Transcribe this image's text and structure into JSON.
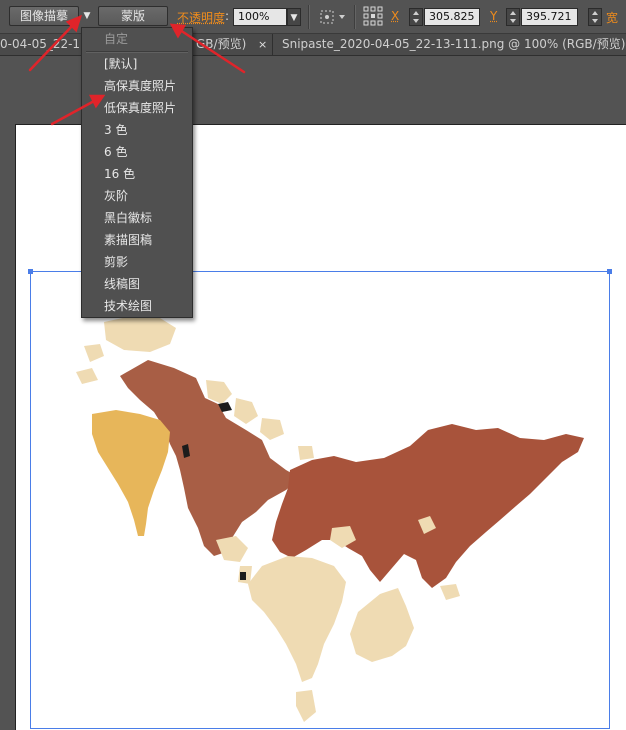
{
  "control_bar": {
    "image_trace_label": "图像描摹",
    "mask_label": "蒙版",
    "opacity_label": "不透明度",
    "opacity_colon": ":",
    "opacity_value": "100%",
    "x_label": "X",
    "x_value": "305.825",
    "y_label": "Y",
    "y_value": "395.721",
    "width_label": "宽"
  },
  "tabs": [
    {
      "label": "0-04-05_22-13-"
    },
    {
      "label": "GB/预览)"
    },
    {
      "label": "Snipaste_2020-04-05_22-13-111.png @ 100% (RGB/预览)"
    }
  ],
  "tab_close_glyph": "×",
  "menu": {
    "header": "自定",
    "items": [
      {
        "label": "[默认]"
      },
      {
        "label": "高保真度照片"
      },
      {
        "label": "低保真度照片"
      },
      {
        "label": "3 色"
      },
      {
        "label": "6 色"
      },
      {
        "label": "16 色"
      },
      {
        "label": "灰阶"
      },
      {
        "label": "黑白徽标"
      },
      {
        "label": "素描图稿"
      },
      {
        "label": "剪影"
      },
      {
        "label": "线稿图"
      },
      {
        "label": "技术绘图"
      }
    ]
  },
  "colors": {
    "eurasia": "#a8533b",
    "north_america": "#a85e45",
    "south_america": "#e7b65a",
    "africa": "#efdbb3",
    "arrow": "#e0242a",
    "selection": "#4a7de8"
  }
}
